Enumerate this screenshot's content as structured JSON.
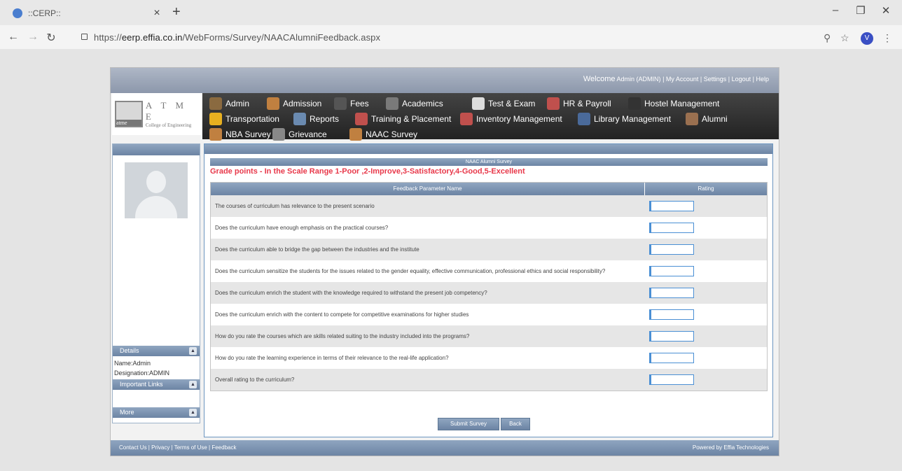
{
  "browser": {
    "tab_title": "::CERP::",
    "new_tab": "+",
    "tab_close": "×",
    "url_scheme": "https://",
    "url_host": "eerp.effia.co.in",
    "url_path": "/WebForms/Survey/NAACAlumniFeedback.aspx",
    "profile_initial": "V"
  },
  "header": {
    "welcome": "Welcome",
    "welcome_user": "Admin (ADMIN)",
    "links": " |  My Account  |  Settings  |  Logout  |  Help"
  },
  "logo": {
    "letters": "A T M E",
    "subtitle": "College of Engineering",
    "box_text": "atme"
  },
  "menu": [
    {
      "label": "Admin",
      "icon": "admin-icon",
      "color": "#8a6a40"
    },
    {
      "label": "Admission",
      "icon": "admission-icon",
      "color": "#c08040"
    },
    {
      "label": "Fees",
      "icon": "rupee-icon",
      "color": "#555555"
    },
    {
      "label": "Academics",
      "icon": "books-icon",
      "color": "#7a7a7a"
    },
    {
      "label": "Test & Exam",
      "icon": "pencil-icon",
      "color": "#dddddd"
    },
    {
      "label": "HR & Payroll",
      "icon": "people-icon",
      "color": "#c0504d"
    },
    {
      "label": "Hostel Management",
      "icon": "hostel-icon",
      "color": "#333333"
    },
    {
      "label": "Transportation",
      "icon": "bus-icon",
      "color": "#e8b020"
    },
    {
      "label": "Reports",
      "icon": "reports-icon",
      "color": "#6a8ab0"
    },
    {
      "label": "Training & Placement",
      "icon": "training-icon",
      "color": "#c0504d"
    },
    {
      "label": "Inventory Management",
      "icon": "inventory-icon",
      "color": "#c0504d"
    },
    {
      "label": "Library Management",
      "icon": "library-icon",
      "color": "#4a6a9a"
    },
    {
      "label": "Alumni",
      "icon": "alumni-icon",
      "color": "#9a7050"
    },
    {
      "label": "NBA Survey",
      "icon": "nba-survey-icon",
      "color": "#c08040"
    },
    {
      "label": "Grievance",
      "icon": "grievance-icon",
      "color": "#888888"
    },
    {
      "label": "NAAC Survey",
      "icon": "naac-survey-icon",
      "color": "#c08040"
    }
  ],
  "sidebar": {
    "details_title": "Details",
    "name": "Name:Admin",
    "designation": "Designation:ADMIN",
    "important_links_title": "Important Links",
    "more_title": "More",
    "collapse_glyph": "▲"
  },
  "survey": {
    "title": "NAAC Alumni Survey",
    "grade_points": "Grade points - In the Scale Range 1-Poor ,2-Improve,3-Satisfactory,4-Good,5-Excellent",
    "col_parameter": "Feedback Parameter Name",
    "col_rating": "Rating",
    "questions": [
      "The courses of curriculum has relevance to the present scenario",
      "Does the curriculum have enough emphasis on the practical courses?",
      "Does the curriculum able to bridge the gap between the industries and the institute",
      "Does the curriculum sensitize the students for the issues related to the gender equality, effective communication, professional ethics and social responsibility?",
      "Does the curriculum enrich the student with the knowledge required to withstand the present job competency?",
      "Does the curriculum enrich with the content to compete for competitive examinations for higher studies",
      "How do you rate the courses which are skills related suiting to the industry included into the programs?",
      "How do you rate the learning experience in terms of their relevance to the real-life application?",
      "Overall rating to the curriculum?"
    ],
    "submit_label": "Submit Survey",
    "back_label": "Back"
  },
  "footer": {
    "links": "Contact Us  |  Privacy  |  Terms of Use  |  Feedback",
    "powered": "Powered by Effia Technologies"
  },
  "colors": {
    "grade_text": "#e8384a",
    "header_blue": "#7f95b3",
    "input_border": "#4a8fd4"
  }
}
